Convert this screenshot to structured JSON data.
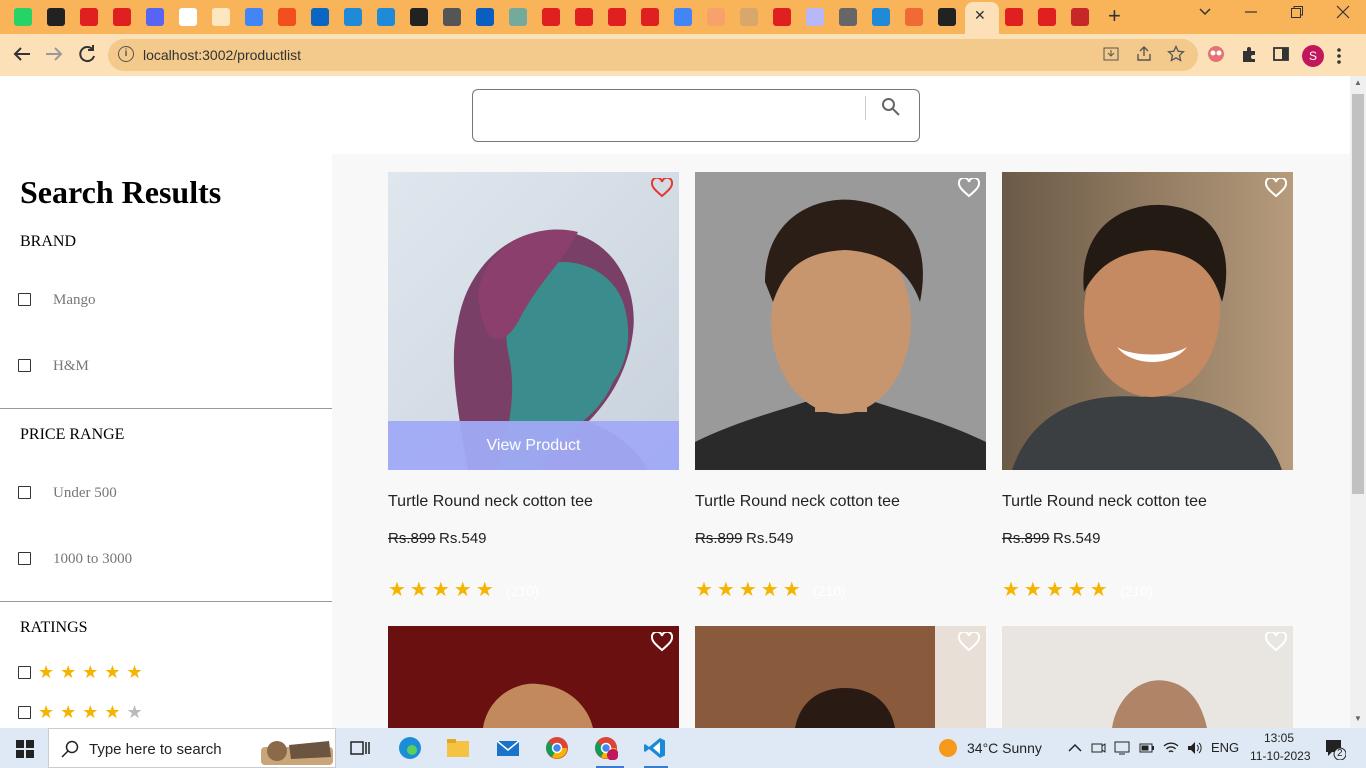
{
  "browser": {
    "url": "localhost:3002/productlist",
    "close_tab": "✕",
    "new_tab": "+",
    "profile_initial": "S",
    "accent": "#f9b45a"
  },
  "sidebar": {
    "title": "Search Results",
    "brand_heading": "BRAND",
    "brands": [
      "Mango",
      "H&M"
    ],
    "price_heading": "PRICE RANGE",
    "prices": [
      "Under 500",
      "1000 to 3000"
    ],
    "ratings_heading": "RATINGS",
    "ratings": [
      5,
      4
    ]
  },
  "products": [
    {
      "title": "Turtle Round neck cotton tee",
      "old_price": "Rs.899",
      "price": "Rs.549",
      "rating": 5,
      "reviews": "(210)",
      "liked": true,
      "view_label": "View Product"
    },
    {
      "title": "Turtle Round neck cotton tee",
      "old_price": "Rs.899",
      "price": "Rs.549",
      "rating": 5,
      "reviews": "(210)",
      "liked": false
    },
    {
      "title": "Turtle Round neck cotton tee",
      "old_price": "Rs.899",
      "price": "Rs.549",
      "rating": 5,
      "reviews": "(210)",
      "liked": false
    }
  ],
  "taskbar": {
    "search_placeholder": "Type here to search",
    "weather": "34°C  Sunny",
    "lang": "ENG",
    "time": "13:05",
    "date": "11-10-2023",
    "notifications": "2"
  }
}
